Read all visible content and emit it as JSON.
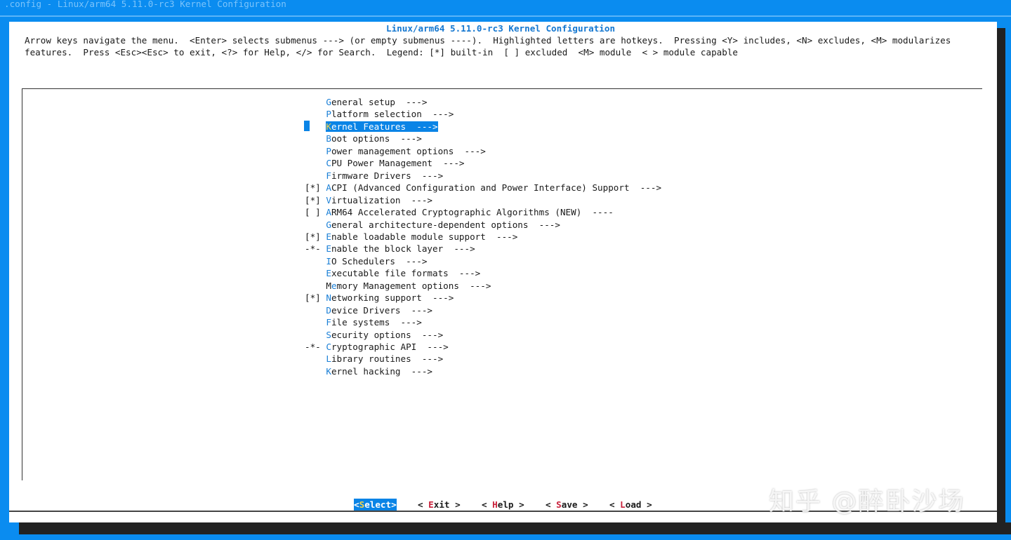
{
  "window": {
    "title": ".config - Linux/arm64 5.11.0-rc3 Kernel Configuration"
  },
  "dialog": {
    "title": "Linux/arm64 5.11.0-rc3 Kernel Configuration",
    "help_line1": "Arrow keys navigate the menu.  <Enter> selects submenus ---> (or empty submenus ----).  Highlighted letters are hotkeys.  Pressing <Y> includes, <N> excludes, <M> modularizes",
    "help_line2": "features.  Press <Esc><Esc> to exit, <?> for Help, </> for Search.  Legend: [*] built-in  [ ] excluded  <M> module  < > module capable"
  },
  "menu": {
    "selected_index": 2,
    "items": [
      {
        "prefix": "    ",
        "hotkey": "G",
        "rest": "eneral setup  --->"
      },
      {
        "prefix": "    ",
        "hotkey": "P",
        "rest": "latform selection  --->"
      },
      {
        "prefix": "    ",
        "hotkey": "K",
        "rest": "ernel Features  --->"
      },
      {
        "prefix": "    ",
        "hotkey": "B",
        "rest": "oot options  --->"
      },
      {
        "prefix": "    ",
        "hotkey": "P",
        "rest": "ower management options  --->"
      },
      {
        "prefix": "    ",
        "hotkey": "C",
        "rest": "PU Power Management  --->"
      },
      {
        "prefix": "    ",
        "hotkey": "F",
        "rest": "irmware Drivers  --->"
      },
      {
        "prefix": "[*] ",
        "hotkey": "A",
        "rest": "CPI (Advanced Configuration and Power Interface) Support  --->"
      },
      {
        "prefix": "[*] ",
        "hotkey": "V",
        "rest": "irtualization  --->"
      },
      {
        "prefix": "[ ] ",
        "hotkey": "A",
        "rest": "RM64 Accelerated Cryptographic Algorithms (NEW)  ----"
      },
      {
        "prefix": "    ",
        "hotkey": "G",
        "rest": "eneral architecture-dependent options  --->"
      },
      {
        "prefix": "[*] ",
        "hotkey": "E",
        "rest": "nable loadable module support  --->"
      },
      {
        "prefix": "-*- ",
        "hotkey": "E",
        "rest": "nable the block layer  --->"
      },
      {
        "prefix": "    ",
        "hotkey": "I",
        "rest": "O Schedulers  --->"
      },
      {
        "prefix": "    ",
        "hotkey": "E",
        "rest": "xecutable file formats  --->"
      },
      {
        "prefix": "    ",
        "pre": "M",
        "hotkey": "e",
        "rest": "mory Management options  --->"
      },
      {
        "prefix": "[*] ",
        "hotkey": "N",
        "rest": "etworking support  --->"
      },
      {
        "prefix": "    ",
        "hotkey": "D",
        "rest": "evice Drivers  --->"
      },
      {
        "prefix": "    ",
        "hotkey": "F",
        "rest": "ile systems  --->"
      },
      {
        "prefix": "    ",
        "hotkey": "S",
        "rest": "ecurity options  --->"
      },
      {
        "prefix": "-*- ",
        "hotkey": "C",
        "rest": "ryptographic API  --->"
      },
      {
        "prefix": "    ",
        "hotkey": "L",
        "rest": "ibrary routines  --->"
      },
      {
        "prefix": "    ",
        "hotkey": "K",
        "rest": "ernel hacking  --->"
      }
    ]
  },
  "buttons": [
    {
      "open": "<",
      "hotkey": "S",
      "rest": "elect",
      "close": ">"
    },
    {
      "open": "< ",
      "hotkey": "E",
      "rest": "xit",
      "close": " >"
    },
    {
      "open": "< ",
      "hotkey": "H",
      "rest": "elp",
      "close": " >"
    },
    {
      "open": "< ",
      "hotkey": "S",
      "rest": "ave",
      "close": " >"
    },
    {
      "open": "< ",
      "hotkey": "L",
      "rest": "oad",
      "close": " >"
    }
  ],
  "watermark": "知乎 @醉卧沙场",
  "colors": {
    "background": "#0a8cf0",
    "highlight": "#0a84e6",
    "menu_hotkey": "#1a7fd6",
    "button_hotkey": "#c8203a",
    "selected_hotkey": "#f3d24a"
  }
}
